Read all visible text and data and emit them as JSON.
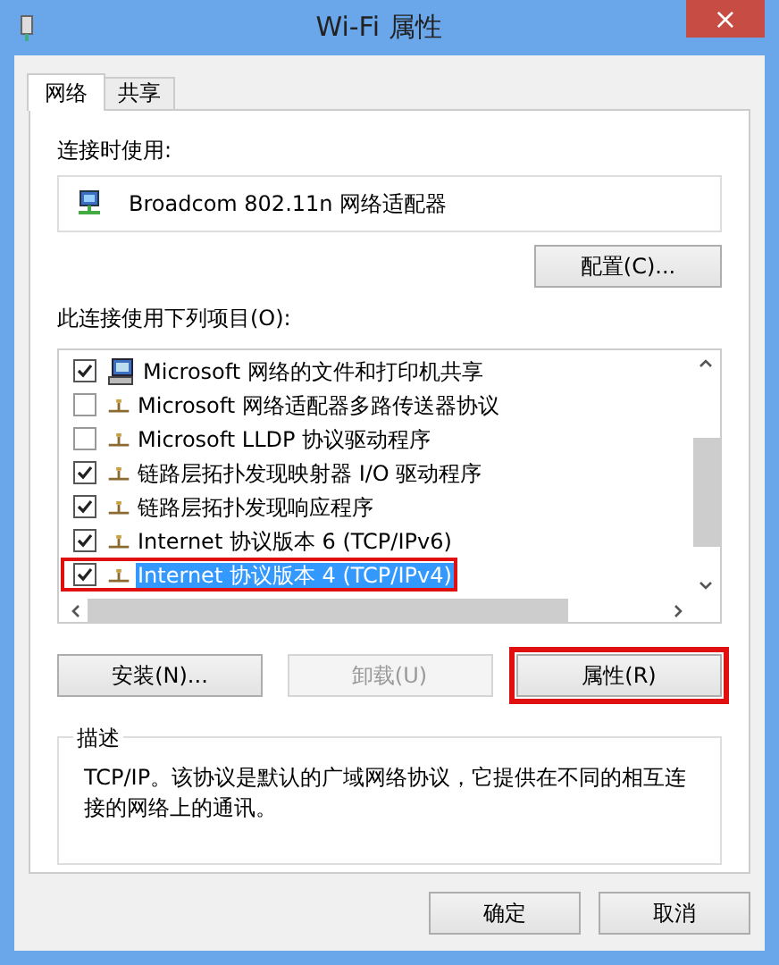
{
  "window": {
    "title": "Wi-Fi 属性",
    "close": "×"
  },
  "tabs": [
    {
      "label": "网络",
      "selected": true
    },
    {
      "label": "共享",
      "selected": false
    }
  ],
  "connect_using": {
    "label": "连接时使用:",
    "adapter": "Broadcom 802.11n 网络适配器",
    "configure_button": "配置(C)..."
  },
  "items_label": "此连接使用下列项目(O):",
  "items": [
    {
      "kind": "service",
      "label": "Microsoft 网络的文件和打印机共享",
      "checked": true,
      "selected": false,
      "highlighted": false
    },
    {
      "kind": "protocol",
      "label": "Microsoft 网络适配器多路传送器协议",
      "checked": false,
      "selected": false,
      "highlighted": false
    },
    {
      "kind": "protocol",
      "label": "Microsoft LLDP 协议驱动程序",
      "checked": false,
      "selected": false,
      "highlighted": false
    },
    {
      "kind": "protocol",
      "label": "链路层拓扑发现映射器 I/O 驱动程序",
      "checked": true,
      "selected": false,
      "highlighted": false
    },
    {
      "kind": "protocol",
      "label": "链路层拓扑发现响应程序",
      "checked": true,
      "selected": false,
      "highlighted": false
    },
    {
      "kind": "protocol",
      "label": "Internet 协议版本 6 (TCP/IPv6)",
      "checked": true,
      "selected": false,
      "highlighted": false
    },
    {
      "kind": "protocol",
      "label": "Internet 协议版本 4 (TCP/IPv4)",
      "checked": true,
      "selected": true,
      "highlighted": true
    }
  ],
  "item_buttons": [
    {
      "label": "安装(N)...",
      "disabled": false,
      "highlighted": false
    },
    {
      "label": "卸载(U)",
      "disabled": true,
      "highlighted": false
    },
    {
      "label": "属性(R)",
      "disabled": false,
      "highlighted": true
    }
  ],
  "description": {
    "legend": "描述",
    "text": "TCP/IP。该协议是默认的广域网络协议，它提供在不同的相互连接的网络上的通讯。"
  },
  "dialog_buttons": [
    "确定",
    "取消"
  ]
}
